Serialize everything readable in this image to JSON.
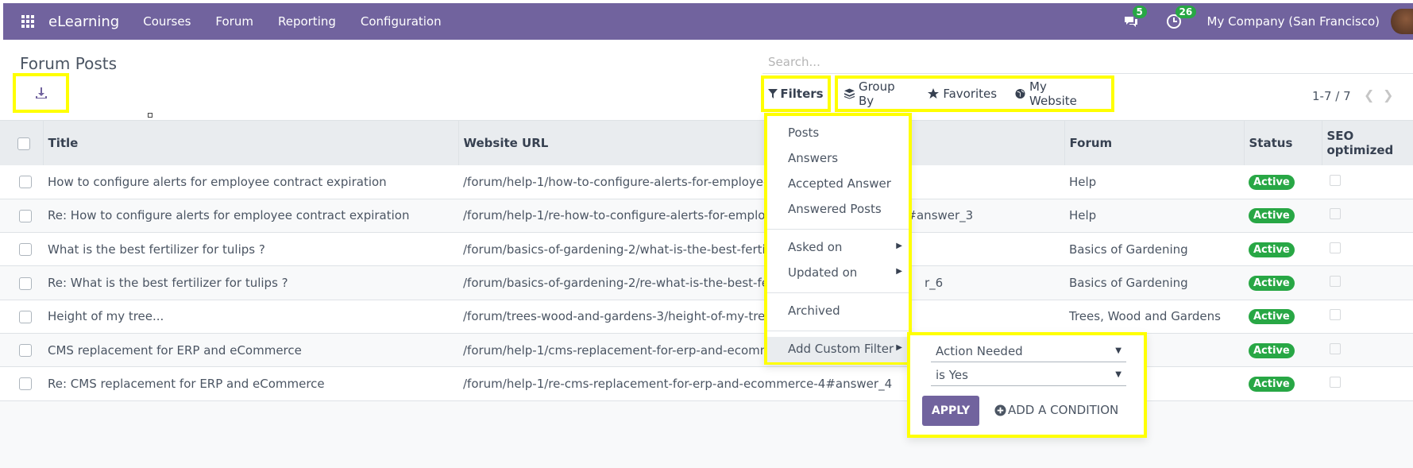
{
  "navbar": {
    "brand": "eLearning",
    "menu": [
      "Courses",
      "Forum",
      "Reporting",
      "Configuration"
    ],
    "messages_count": "5",
    "activities_count": "26",
    "company": "My Company (San Francisco)"
  },
  "control_panel": {
    "title": "Forum Posts",
    "search_placeholder": "Search...",
    "filters_label": "Filters",
    "group_by_label": "Group By",
    "favorites_label": "Favorites",
    "website_label": "My Website",
    "pager": "1-7 / 7"
  },
  "table": {
    "headers": {
      "title": "Title",
      "url": "Website URL",
      "forum": "Forum",
      "status": "Status",
      "seo": "SEO optimized"
    },
    "rows": [
      {
        "title": "How to configure alerts for employee contract expiration",
        "url": "/forum/help-1/how-to-configure-alerts-for-employee",
        "forum": "Help",
        "status": "Active"
      },
      {
        "title": "Re: How to configure alerts for employee contract expiration",
        "url": "/forum/help-1/re-how-to-configure-alerts-for-emplo",
        "url_tail": "#answer_3",
        "forum": "Help",
        "status": "Active"
      },
      {
        "title": "What is the best fertilizer for tulips ?",
        "url": "/forum/basics-of-gardening-2/what-is-the-best-fertil",
        "forum": "Basics of Gardening",
        "status": "Active"
      },
      {
        "title": "Re: What is the best fertilizer for tulips ?",
        "url": "/forum/basics-of-gardening-2/re-what-is-the-best-fe",
        "url_tail": "r_6",
        "forum": "Basics of Gardening",
        "status": "Active"
      },
      {
        "title": "Height of my tree...",
        "url": "/forum/trees-wood-and-gardens-3/height-of-my-tree",
        "forum": "Trees, Wood and Gardens",
        "status": "Active"
      },
      {
        "title": "CMS replacement for ERP and eCommerce",
        "url": "/forum/help-1/cms-replacement-for-erp-and-ecomm",
        "forum": "",
        "status": "Active"
      },
      {
        "title": "Re: CMS replacement for ERP and eCommerce",
        "url": "/forum/help-1/re-cms-replacement-for-erp-and-ecommerce-4#answer_4",
        "forum": "",
        "status": "Active"
      }
    ]
  },
  "filters_dropdown": {
    "items": [
      "Posts",
      "Answers",
      "Accepted Answer",
      "Answered Posts"
    ],
    "date_items": [
      "Asked on",
      "Updated on"
    ],
    "archived": "Archived",
    "custom": "Add Custom Filter"
  },
  "custom_filter": {
    "field": "Action Needed",
    "operator": "is Yes",
    "apply": "APPLY",
    "add_condition": "ADD A CONDITION"
  },
  "colors": {
    "brand": "#71639e",
    "success": "#28a745",
    "highlight": "#ffff00"
  }
}
